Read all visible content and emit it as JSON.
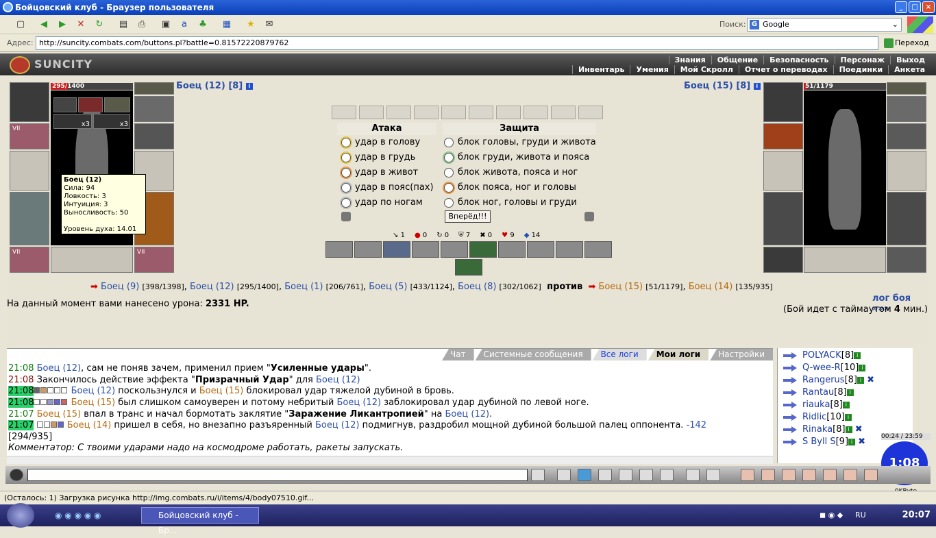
{
  "window": {
    "title": "Бойцовский клуб - Браузер пользователя"
  },
  "toolbar": {
    "search_label": "Поиск:",
    "search_engine": "Google"
  },
  "address": {
    "label": "Адрес:",
    "url": "http://suncity.combats.com/buttons.pl?battle=0.81572220879762",
    "go": "Переход"
  },
  "game": {
    "logo": "SUNCITY",
    "menu_top": [
      "Знания",
      "Общение",
      "Безопасность",
      "Персонаж",
      "Выход"
    ],
    "menu_bottom": [
      "Инвентарь",
      "Умения",
      "Мой Скролл",
      "Отчет о переводах",
      "Поединки",
      "Анкета"
    ]
  },
  "player": {
    "name": "Боец (12) [8]",
    "hp": "295/1400",
    "hp_frac": 0.21
  },
  "enemy": {
    "name": "Боец (15) [8]",
    "hp": "51/1179",
    "hp_frac": 0.04
  },
  "tooltip": {
    "name": "Боец (12)",
    "lines": [
      "Сила: 94",
      "Ловкость: 3",
      "Интуиция: 3",
      "Выносливость: 50",
      "",
      "Уровень духа: 14.01"
    ]
  },
  "slots": {
    "x3a": "x3",
    "x3b": "x3",
    "sevens": "VII"
  },
  "battle": {
    "attack_head": "Атака",
    "defense_head": "Защита",
    "attacks": [
      "удар в голову",
      "удар в грудь",
      "удар в живот",
      "удар в пояс(пах)",
      "удар по ногам"
    ],
    "defenses": [
      "блок головы, груди и живота",
      "блок груди, живота и пояса",
      "блок живота, пояса и ног",
      "блок пояса, ног и головы",
      "блок ног, головы и груди"
    ],
    "forward": "Вперёд!!!",
    "counters": [
      "1",
      "0",
      "0",
      "7",
      "0",
      "9",
      "14"
    ]
  },
  "teams": {
    "left": [
      {
        "name": "Боец (9)",
        "hp": "[398/1398]"
      },
      {
        "name": "Боец (12)",
        "hp": "[295/1400]"
      },
      {
        "name": "Боец (1)",
        "hp": "[206/761]"
      },
      {
        "name": "Боец (5)",
        "hp": "[433/1124]"
      },
      {
        "name": "Боец (8)",
        "hp": "[302/1062]"
      }
    ],
    "vs": "против",
    "right": [
      {
        "name": "Боец (15)",
        "hp": "[51/1179]"
      },
      {
        "name": "Боец (14)",
        "hp": "[135/935]"
      }
    ]
  },
  "damage": {
    "prefix": "На данный момент вами нанесено урона:",
    "value": "2331 HP."
  },
  "log_link": "лог боя »»»",
  "timeout": {
    "prefix": "(Бой идет с таймаутом",
    "value": "4",
    "suffix": "мин.)"
  },
  "chat": {
    "tabs": [
      "Чат",
      "Системные сообщения",
      "Все логи",
      "Мои логи",
      "Настройки"
    ],
    "lines": [
      {
        "time": "21:08",
        "a": "Боец (12)",
        "t1": ", сам не поняв зачем, применил прием \"",
        "b": "Усиленные удары",
        "t2": "\"."
      },
      {
        "time": "21:08",
        "t1": "Закончилось действие эффекта \"",
        "b": "Призрачный Удар",
        "t2": "\" для ",
        "a": "Боец (12)"
      },
      {
        "time": "21:08",
        "a": "Боец (12)",
        "t1": " поскользнулся и ",
        "c": "Боец (15)",
        "t2": " блокировал удар тяжелой дубиной в бровь."
      },
      {
        "time": "21:08",
        "c": "Боец (15)",
        "t1": " был слишком самоуверен и потому небритый ",
        "a": "Боец (12)",
        "t2": " заблокировал удар дубиной по левой ноге."
      },
      {
        "time": "21:07",
        "c": "Боец (15)",
        "t1": " впал в транс и начал бормотать заклятие \"",
        "b": "Заражение Ликантропией",
        "t2": "\" на ",
        "a": "Боец (12)"
      },
      {
        "time": "21:07",
        "c": "Боец (14)",
        "t1": " пришел в себя, но внезапно разъяренный ",
        "a": "Боец (12)",
        "t2": " подмигнув, раздробил мощной дубиной большой палец оппонента.",
        "dmg": "-142"
      }
    ],
    "hp_line": "[294/935]",
    "comment": "Комментатор: С твоими ударами надо на космодроме работать, ракеты запускать."
  },
  "users": [
    {
      "name": "POLYACK",
      "lvl": "[8]"
    },
    {
      "name": "Q-wee-R",
      "lvl": "[10]"
    },
    {
      "name": "Rangerus",
      "lvl": "[8]"
    },
    {
      "name": "Rantau",
      "lvl": "[8]"
    },
    {
      "name": "riauka",
      "lvl": "[8]"
    },
    {
      "name": "Ridlic",
      "lvl": "[10]"
    },
    {
      "name": "Rinaka",
      "lvl": "[8]"
    },
    {
      "name": "S Byll S",
      "lvl": "[9]"
    }
  ],
  "clock": {
    "range": "00:24 / 23:59",
    "time": "1:08",
    "bytes": "0KByte"
  },
  "status": "(Осталось: 1) Загрузка рисунка http://img.combats.ru/i/items/4/body07510.gif...",
  "taskbar": {
    "task": "Бойцовский клуб - Бр...",
    "lang": "RU",
    "time": "20:07"
  },
  "colors": {
    "accent_blue": "#2b4fa8",
    "enemy_orange": "#b86a10",
    "hp_red": "#c41e1e"
  }
}
